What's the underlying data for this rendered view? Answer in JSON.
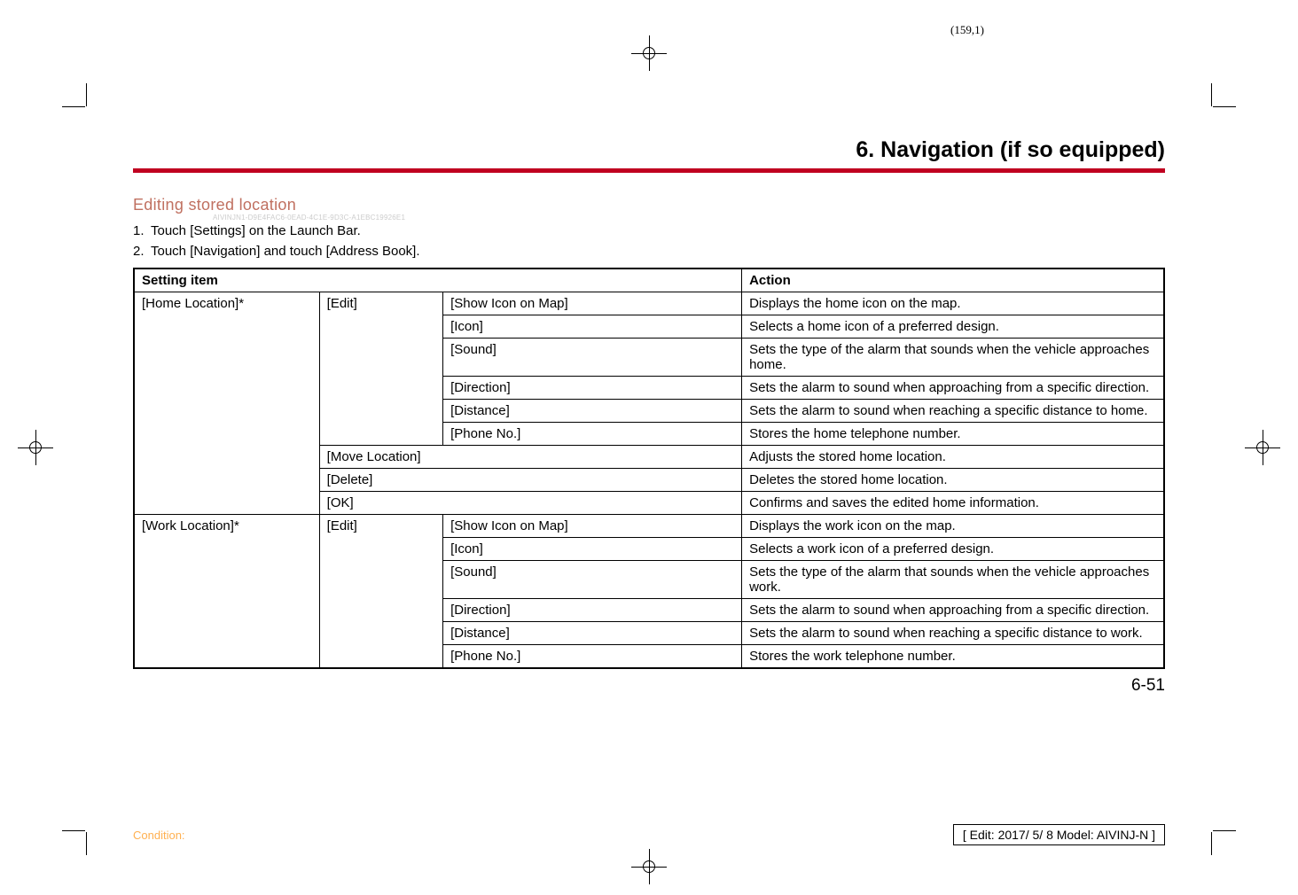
{
  "page_coord": "(159,1)",
  "chapter_title": "6. Navigation (if so equipped)",
  "section_heading": "Editing stored location",
  "hash": "AIVINJN1-D9E4FAC6-0EAD-4C1E-9D3C-A1EBC19926E1",
  "steps": [
    "Touch [Settings] on the Launch Bar.",
    "Touch [Navigation] and touch [Address Book]."
  ],
  "table": {
    "header": {
      "col1": "Setting item",
      "col2": "Action"
    },
    "rows": [
      {
        "c1": "[Home Location]*",
        "c1rows": 9,
        "c2": "[Edit]",
        "c2rows": 6,
        "c3": "[Show Icon on Map]",
        "c4": "Displays the home icon on the map."
      },
      {
        "c3": "[Icon]",
        "c4": "Selects a home icon of a preferred design."
      },
      {
        "c3": "[Sound]",
        "c4": "Sets the type of the alarm that sounds when the vehicle approaches home."
      },
      {
        "c3": "[Direction]",
        "c4": "Sets the alarm to sound when approaching from a specific direction."
      },
      {
        "c3": "[Distance]",
        "c4": "Sets the alarm to sound when reaching a specific distance to home."
      },
      {
        "c3": "[Phone No.]",
        "c4": "Stores the home telephone number."
      },
      {
        "c2span": "[Move Location]",
        "c4": "Adjusts the stored home location."
      },
      {
        "c2span": "[Delete]",
        "c4": "Deletes the stored home location."
      },
      {
        "c2span": "[OK]",
        "c4": "Confirms and saves the edited home information."
      },
      {
        "c1": "[Work Location]*",
        "c1rows": 6,
        "c2": "[Edit]",
        "c2rows": 6,
        "c3": "[Show Icon on Map]",
        "c4": "Displays the work icon on the map."
      },
      {
        "c3": "[Icon]",
        "c4": "Selects a work icon of a preferred design."
      },
      {
        "c3": "[Sound]",
        "c4": "Sets the type of the alarm that sounds when the vehicle approaches work."
      },
      {
        "c3": "[Direction]",
        "c4": "Sets the alarm to sound when approaching from a specific direction."
      },
      {
        "c3": "[Distance]",
        "c4": "Sets the alarm to sound when reaching a specific distance to work."
      },
      {
        "c3": "[Phone No.]",
        "c4": "Stores the work telephone number."
      }
    ]
  },
  "page_num": "6-51",
  "footer_left": "Condition:",
  "footer_right": "[ Edit: 2017/ 5/ 8   Model: AIVINJ-N ]"
}
